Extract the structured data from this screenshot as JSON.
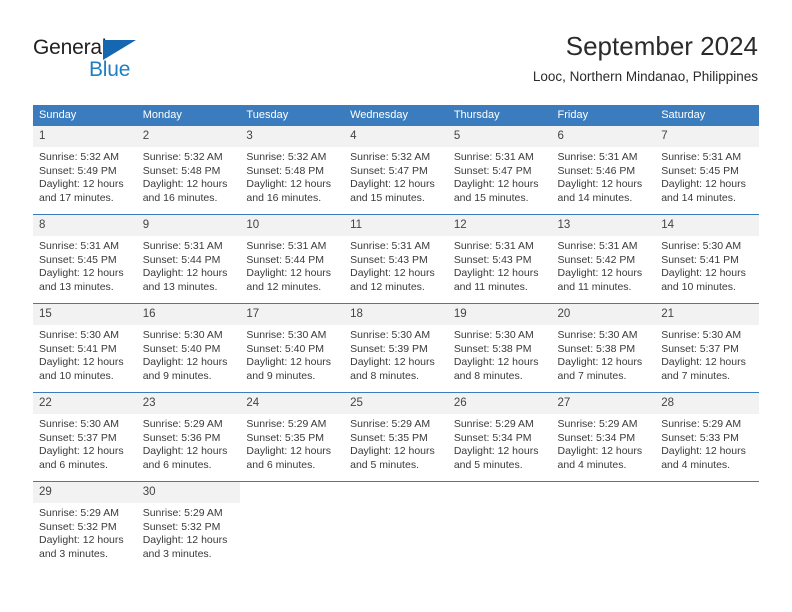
{
  "brand": {
    "name_top": "General",
    "name_bottom": "Blue",
    "triangle_icon": "blue-triangle-logo-mark",
    "color_dark": "#231f20",
    "color_blue": "#1f7fc4"
  },
  "header": {
    "month_title": "September 2024",
    "location": "Looc, Northern Mindanao, Philippines"
  },
  "theme": {
    "header_row_bg": "#3b7cbe",
    "daynum_bg": "#f2f2f2",
    "divider": "#3b7cbe",
    "text": "#3a3a3a"
  },
  "weekdays": [
    "Sunday",
    "Monday",
    "Tuesday",
    "Wednesday",
    "Thursday",
    "Friday",
    "Saturday"
  ],
  "weeks": [
    [
      {
        "day": "1",
        "sunrise": "Sunrise: 5:32 AM",
        "sunset": "Sunset: 5:49 PM",
        "daylight_1": "Daylight: 12 hours",
        "daylight_2": "and 17 minutes."
      },
      {
        "day": "2",
        "sunrise": "Sunrise: 5:32 AM",
        "sunset": "Sunset: 5:48 PM",
        "daylight_1": "Daylight: 12 hours",
        "daylight_2": "and 16 minutes."
      },
      {
        "day": "3",
        "sunrise": "Sunrise: 5:32 AM",
        "sunset": "Sunset: 5:48 PM",
        "daylight_1": "Daylight: 12 hours",
        "daylight_2": "and 16 minutes."
      },
      {
        "day": "4",
        "sunrise": "Sunrise: 5:32 AM",
        "sunset": "Sunset: 5:47 PM",
        "daylight_1": "Daylight: 12 hours",
        "daylight_2": "and 15 minutes."
      },
      {
        "day": "5",
        "sunrise": "Sunrise: 5:31 AM",
        "sunset": "Sunset: 5:47 PM",
        "daylight_1": "Daylight: 12 hours",
        "daylight_2": "and 15 minutes."
      },
      {
        "day": "6",
        "sunrise": "Sunrise: 5:31 AM",
        "sunset": "Sunset: 5:46 PM",
        "daylight_1": "Daylight: 12 hours",
        "daylight_2": "and 14 minutes."
      },
      {
        "day": "7",
        "sunrise": "Sunrise: 5:31 AM",
        "sunset": "Sunset: 5:45 PM",
        "daylight_1": "Daylight: 12 hours",
        "daylight_2": "and 14 minutes."
      }
    ],
    [
      {
        "day": "8",
        "sunrise": "Sunrise: 5:31 AM",
        "sunset": "Sunset: 5:45 PM",
        "daylight_1": "Daylight: 12 hours",
        "daylight_2": "and 13 minutes."
      },
      {
        "day": "9",
        "sunrise": "Sunrise: 5:31 AM",
        "sunset": "Sunset: 5:44 PM",
        "daylight_1": "Daylight: 12 hours",
        "daylight_2": "and 13 minutes."
      },
      {
        "day": "10",
        "sunrise": "Sunrise: 5:31 AM",
        "sunset": "Sunset: 5:44 PM",
        "daylight_1": "Daylight: 12 hours",
        "daylight_2": "and 12 minutes."
      },
      {
        "day": "11",
        "sunrise": "Sunrise: 5:31 AM",
        "sunset": "Sunset: 5:43 PM",
        "daylight_1": "Daylight: 12 hours",
        "daylight_2": "and 12 minutes."
      },
      {
        "day": "12",
        "sunrise": "Sunrise: 5:31 AM",
        "sunset": "Sunset: 5:43 PM",
        "daylight_1": "Daylight: 12 hours",
        "daylight_2": "and 11 minutes."
      },
      {
        "day": "13",
        "sunrise": "Sunrise: 5:31 AM",
        "sunset": "Sunset: 5:42 PM",
        "daylight_1": "Daylight: 12 hours",
        "daylight_2": "and 11 minutes."
      },
      {
        "day": "14",
        "sunrise": "Sunrise: 5:30 AM",
        "sunset": "Sunset: 5:41 PM",
        "daylight_1": "Daylight: 12 hours",
        "daylight_2": "and 10 minutes."
      }
    ],
    [
      {
        "day": "15",
        "sunrise": "Sunrise: 5:30 AM",
        "sunset": "Sunset: 5:41 PM",
        "daylight_1": "Daylight: 12 hours",
        "daylight_2": "and 10 minutes."
      },
      {
        "day": "16",
        "sunrise": "Sunrise: 5:30 AM",
        "sunset": "Sunset: 5:40 PM",
        "daylight_1": "Daylight: 12 hours",
        "daylight_2": "and 9 minutes."
      },
      {
        "day": "17",
        "sunrise": "Sunrise: 5:30 AM",
        "sunset": "Sunset: 5:40 PM",
        "daylight_1": "Daylight: 12 hours",
        "daylight_2": "and 9 minutes."
      },
      {
        "day": "18",
        "sunrise": "Sunrise: 5:30 AM",
        "sunset": "Sunset: 5:39 PM",
        "daylight_1": "Daylight: 12 hours",
        "daylight_2": "and 8 minutes."
      },
      {
        "day": "19",
        "sunrise": "Sunrise: 5:30 AM",
        "sunset": "Sunset: 5:38 PM",
        "daylight_1": "Daylight: 12 hours",
        "daylight_2": "and 8 minutes."
      },
      {
        "day": "20",
        "sunrise": "Sunrise: 5:30 AM",
        "sunset": "Sunset: 5:38 PM",
        "daylight_1": "Daylight: 12 hours",
        "daylight_2": "and 7 minutes."
      },
      {
        "day": "21",
        "sunrise": "Sunrise: 5:30 AM",
        "sunset": "Sunset: 5:37 PM",
        "daylight_1": "Daylight: 12 hours",
        "daylight_2": "and 7 minutes."
      }
    ],
    [
      {
        "day": "22",
        "sunrise": "Sunrise: 5:30 AM",
        "sunset": "Sunset: 5:37 PM",
        "daylight_1": "Daylight: 12 hours",
        "daylight_2": "and 6 minutes."
      },
      {
        "day": "23",
        "sunrise": "Sunrise: 5:29 AM",
        "sunset": "Sunset: 5:36 PM",
        "daylight_1": "Daylight: 12 hours",
        "daylight_2": "and 6 minutes."
      },
      {
        "day": "24",
        "sunrise": "Sunrise: 5:29 AM",
        "sunset": "Sunset: 5:35 PM",
        "daylight_1": "Daylight: 12 hours",
        "daylight_2": "and 6 minutes."
      },
      {
        "day": "25",
        "sunrise": "Sunrise: 5:29 AM",
        "sunset": "Sunset: 5:35 PM",
        "daylight_1": "Daylight: 12 hours",
        "daylight_2": "and 5 minutes."
      },
      {
        "day": "26",
        "sunrise": "Sunrise: 5:29 AM",
        "sunset": "Sunset: 5:34 PM",
        "daylight_1": "Daylight: 12 hours",
        "daylight_2": "and 5 minutes."
      },
      {
        "day": "27",
        "sunrise": "Sunrise: 5:29 AM",
        "sunset": "Sunset: 5:34 PM",
        "daylight_1": "Daylight: 12 hours",
        "daylight_2": "and 4 minutes."
      },
      {
        "day": "28",
        "sunrise": "Sunrise: 5:29 AM",
        "sunset": "Sunset: 5:33 PM",
        "daylight_1": "Daylight: 12 hours",
        "daylight_2": "and 4 minutes."
      }
    ],
    [
      {
        "day": "29",
        "sunrise": "Sunrise: 5:29 AM",
        "sunset": "Sunset: 5:32 PM",
        "daylight_1": "Daylight: 12 hours",
        "daylight_2": "and 3 minutes."
      },
      {
        "day": "30",
        "sunrise": "Sunrise: 5:29 AM",
        "sunset": "Sunset: 5:32 PM",
        "daylight_1": "Daylight: 12 hours",
        "daylight_2": "and 3 minutes."
      },
      {
        "day": "",
        "sunrise": "",
        "sunset": "",
        "daylight_1": "",
        "daylight_2": ""
      },
      {
        "day": "",
        "sunrise": "",
        "sunset": "",
        "daylight_1": "",
        "daylight_2": ""
      },
      {
        "day": "",
        "sunrise": "",
        "sunset": "",
        "daylight_1": "",
        "daylight_2": ""
      },
      {
        "day": "",
        "sunrise": "",
        "sunset": "",
        "daylight_1": "",
        "daylight_2": ""
      },
      {
        "day": "",
        "sunrise": "",
        "sunset": "",
        "daylight_1": "",
        "daylight_2": ""
      }
    ]
  ]
}
